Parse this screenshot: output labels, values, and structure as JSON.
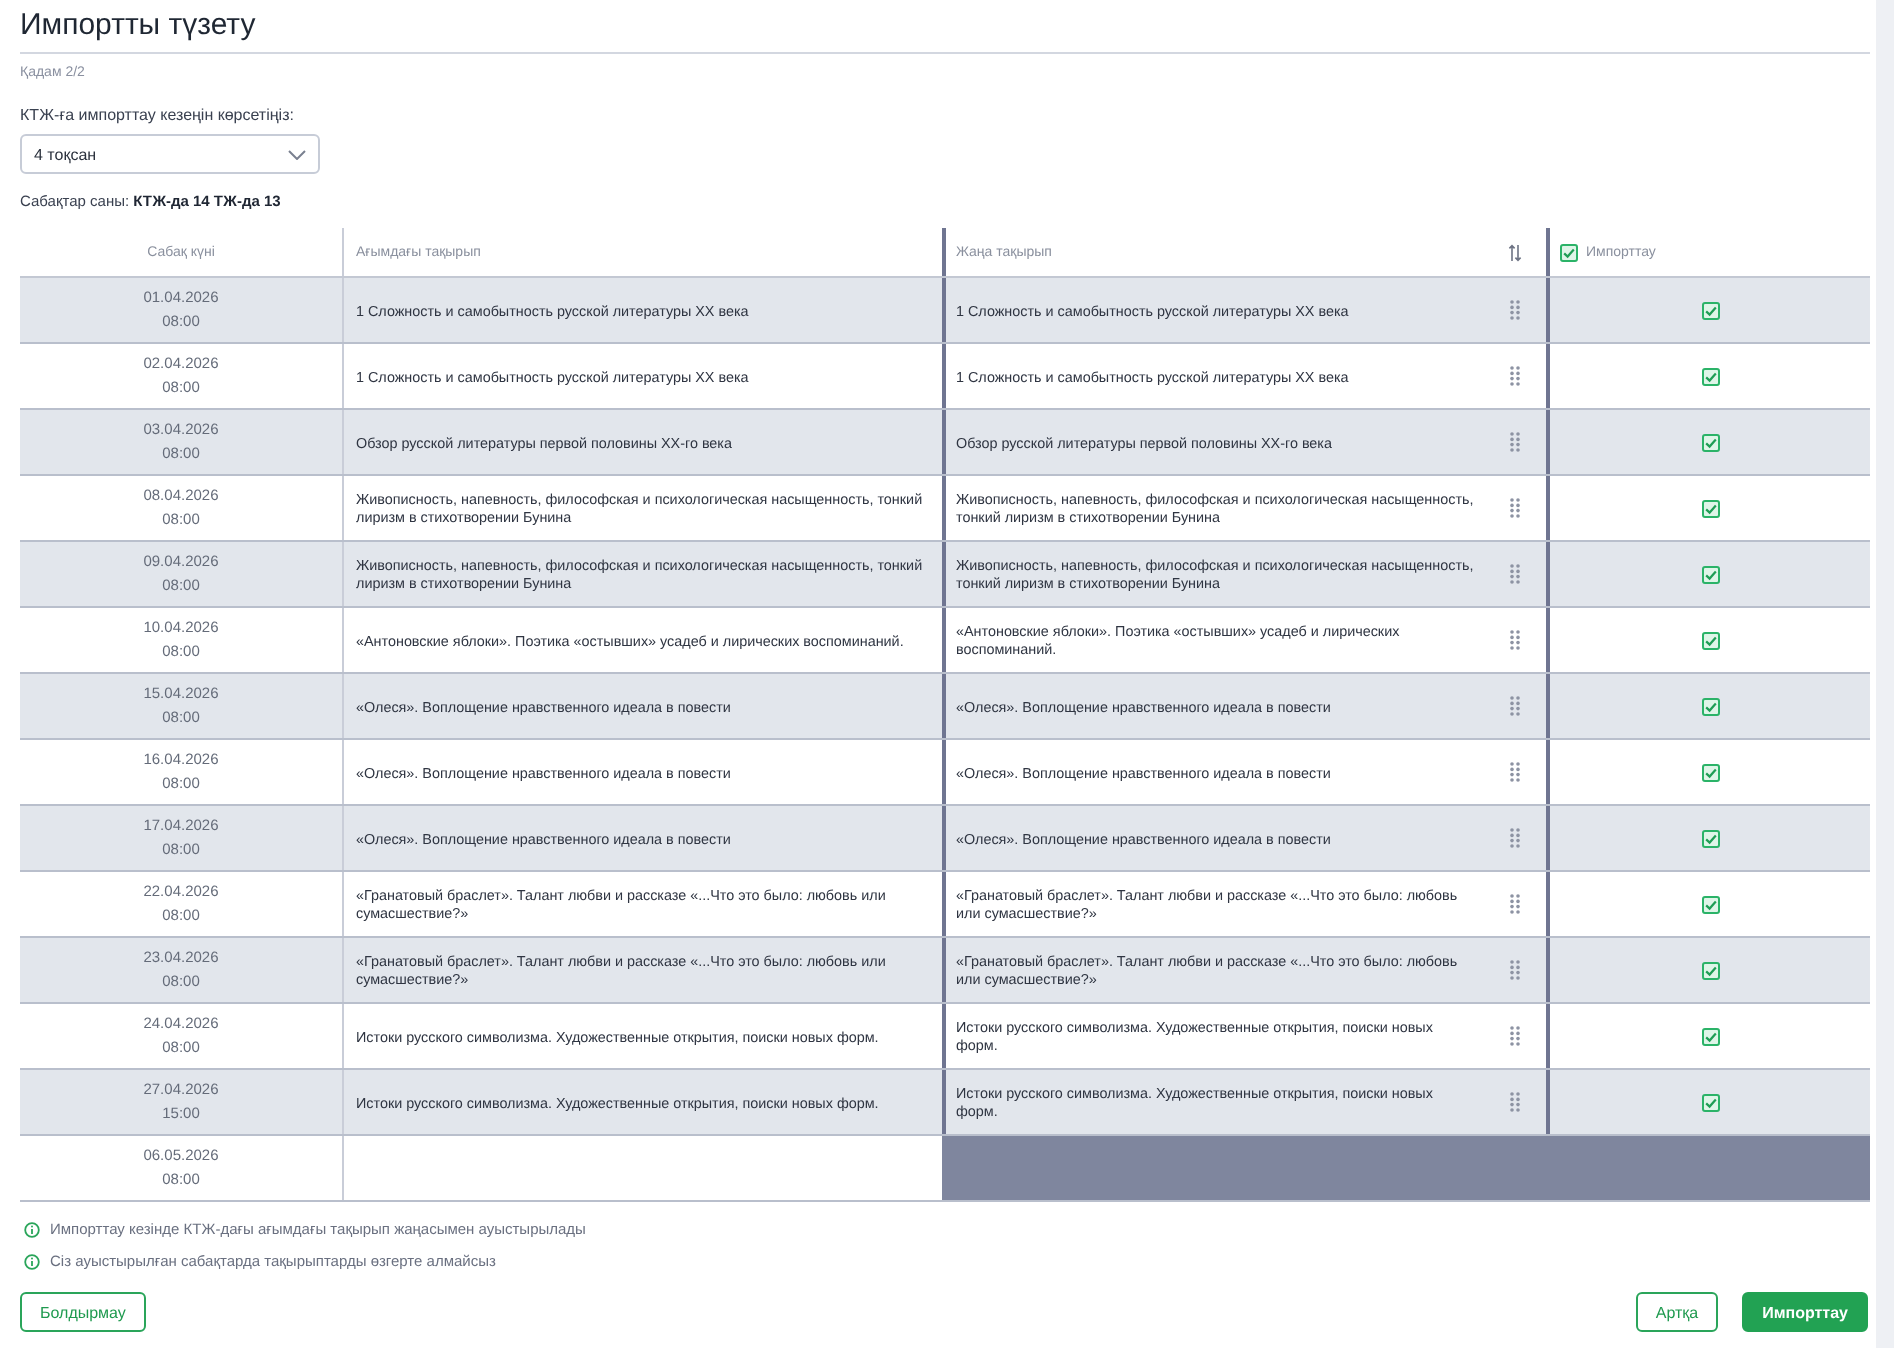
{
  "page": {
    "title": "Импортты түзету",
    "step": "Қадам 2/2"
  },
  "period": {
    "label": "КТЖ-ға импорттау кезеңін көрсетіңіз:",
    "value": "4 тоқсан"
  },
  "lesson_count": "Сабақтар саны: **КТЖ-да 14 ТЖ-да 13**",
  "table": {
    "columns": [
      "Сабақ күні",
      "Ағымдағы тақырып",
      "Жаңа тақырып"
    ],
    "import_column": {
      "label": "Импорттау",
      "checked": true
    },
    "rows": [
      {
        "kind": "matched",
        "date": "01.04.2026",
        "time": "08:00",
        "current_topic": "1 Сложность и самобытность русской литературы XX века",
        "new_topic": "1 Сложность и самобытность русской литературы XX века",
        "checked": true
      },
      {
        "kind": "matched",
        "date": "02.04.2026",
        "time": "08:00",
        "current_topic": "1 Сложность и самобытность русской литературы XX века",
        "new_topic": "1 Сложность и самобытность русской литературы XX века",
        "checked": true
      },
      {
        "kind": "matched",
        "date": "03.04.2026",
        "time": "08:00",
        "current_topic": "Обзор русской литературы первой половины XX-го века",
        "new_topic": "Обзор русской литературы первой половины XX-го века",
        "checked": true
      },
      {
        "kind": "matched",
        "date": "08.04.2026",
        "time": "08:00",
        "current_topic": "Живописность, напевность, философская и психологическая насыщенность, тонкий лиризм в стихотворении Бунина",
        "new_topic": "Живописность, напевность, философская и психологическая насыщенность, тонкий лиризм в стихотворении Бунина",
        "checked": true
      },
      {
        "kind": "matched",
        "date": "09.04.2026",
        "time": "08:00",
        "current_topic": "Живописность, напевность, философская и психологическая насыщенность, тонкий лиризм в стихотворении Бунина",
        "new_topic": "Живописность, напевность, философская и психологическая насыщенность, тонкий лиризм в стихотворении Бунина",
        "checked": true
      },
      {
        "kind": "matched",
        "date": "10.04.2026",
        "time": "08:00",
        "current_topic": "«Антоновские яблоки». Поэтика «остывших» усадеб и лирических воспоминаний.",
        "new_topic": "«Антоновские яблоки». Поэтика «остывших» усадеб и лирических воспоминаний.",
        "checked": true
      },
      {
        "kind": "matched",
        "date": "15.04.2026",
        "time": "08:00",
        "current_topic": "«Олеся». Воплощение нравственного идеала в повести",
        "new_topic": "«Олеся». Воплощение нравственного идеала в повести",
        "checked": true
      },
      {
        "kind": "matched",
        "date": "16.04.2026",
        "time": "08:00",
        "current_topic": "«Олеся». Воплощение нравственного идеала в повести",
        "new_topic": "«Олеся». Воплощение нравственного идеала в повести",
        "checked": true
      },
      {
        "kind": "matched",
        "date": "17.04.2026",
        "time": "08:00",
        "current_topic": "«Олеся». Воплощение нравственного идеала в повести",
        "new_topic": "«Олеся». Воплощение нравственного идеала в повести",
        "checked": true
      },
      {
        "kind": "matched",
        "date": "22.04.2026",
        "time": "08:00",
        "current_topic": "«Гранатовый браслет». Талант любви и рассказе «...Что это было: любовь или сумасшествие?»",
        "new_topic": "«Гранатовый браслет». Талант любви и рассказе «...Что это было: любовь или сумасшествие?»",
        "checked": true
      },
      {
        "kind": "matched",
        "date": "23.04.2026",
        "time": "08:00",
        "current_topic": "«Гранатовый браслет». Талант любви и рассказе «...Что это было: любовь или сумасшествие?»",
        "new_topic": "«Гранатовый браслет». Талант любви и рассказе «...Что это было: любовь или сумасшествие?»",
        "checked": true
      },
      {
        "kind": "matched",
        "date": "24.04.2026",
        "time": "08:00",
        "current_topic": "Истоки русского символизма. Художественные открытия, поиски новых форм.",
        "new_topic": "Истоки русского символизма. Художественные открытия, поиски новых форм.",
        "checked": true
      },
      {
        "kind": "matched",
        "date": "27.04.2026",
        "time": "15:00",
        "current_topic": "Истоки русского символизма. Художественные открытия, поиски новых форм.",
        "new_topic": "Истоки русского символизма. Художественные открытия, поиски новых форм.",
        "checked": true
      },
      {
        "kind": "unmatched",
        "date": "06.05.2026",
        "time": "08:00"
      }
    ]
  },
  "notes": [
    "Импорттау кезінде КТЖ-дағы ағымдағы тақырып жаңасымен ауыстырылады",
    "Сіз ауыстырылған сабақтарда тақырыптарды өзгерте алмайсыз"
  ],
  "footer": {
    "left_buttons": [
      {
        "label": "Болдырмау",
        "kind": "outline"
      }
    ],
    "right_buttons": [
      {
        "label": "Артқа",
        "kind": "outline"
      },
      {
        "label": "Импорттау",
        "kind": "primary"
      }
    ]
  }
}
